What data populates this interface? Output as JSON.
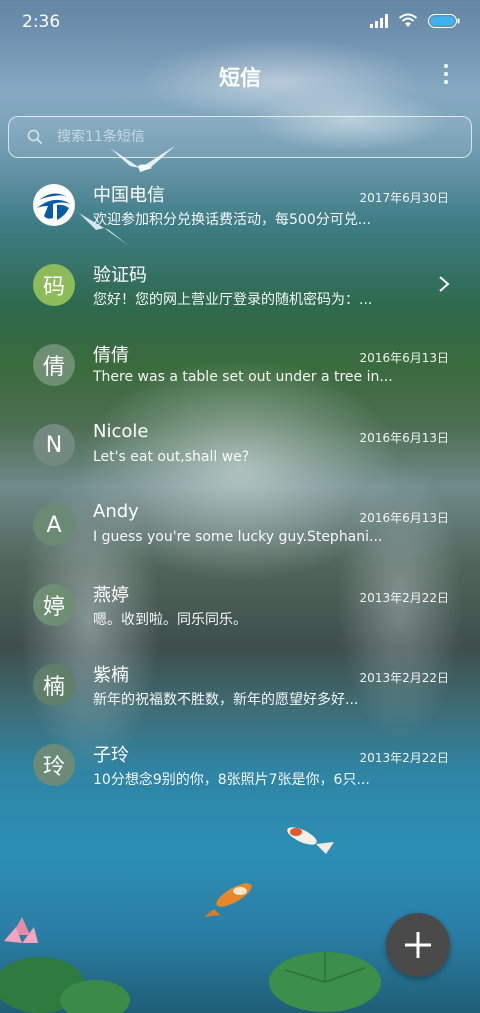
{
  "status_bar": {
    "time": "2:36"
  },
  "header": {
    "title": "短信"
  },
  "search": {
    "placeholder": "搜索11条短信"
  },
  "conversations": [
    {
      "name": "中国电信",
      "date": "2017年6月30日",
      "preview": "欢迎参加积分兑换话费活动，每500分可兑...",
      "avatar_type": "logo",
      "avatar_color": "#ffffff"
    },
    {
      "name": "验证码",
      "date": "",
      "preview": "您好！您的网上营业厅登录的随机密码为：...",
      "avatar_text": "码",
      "avatar_color": "#8dbb5a",
      "has_chevron": true
    },
    {
      "name": "倩倩",
      "date": "2016年6月13日",
      "preview": "There was a table set out under a tree in...",
      "avatar_text": "倩",
      "avatar_color": "#6e8f73"
    },
    {
      "name": "Nicole",
      "date": "2016年6月13日",
      "preview": "Let's eat out,shall we?",
      "avatar_text": "N",
      "avatar_color": "#748a80"
    },
    {
      "name": "Andy",
      "date": "2016年6月13日",
      "preview": "I guess you're some lucky guy.Stephani...",
      "avatar_text": "A",
      "avatar_color": "#6b8a73"
    },
    {
      "name": "燕婷",
      "date": "2013年2月22日",
      "preview": "嗯。收到啦。同乐同乐。",
      "avatar_text": "婷",
      "avatar_color": "#6e8f73"
    },
    {
      "name": "紫楠",
      "date": "2013年2月22日",
      "preview": "新年的祝福数不胜数，新年的愿望好多好...",
      "avatar_text": "楠",
      "avatar_color": "#5f7f6a"
    },
    {
      "name": "子玲",
      "date": "2013年2月22日",
      "preview": "10分想念9别的你，8张照片7张是你，6只...",
      "avatar_text": "玲",
      "avatar_color": "#6b8a78"
    }
  ],
  "icons": {
    "search": "search-icon",
    "more": "more-vert-icon",
    "compose": "plus-icon",
    "chevron": "chevron-right-icon",
    "brand_logo": "china-telecom-logo-icon"
  },
  "colors": {
    "fab": "#4a4a4a",
    "battery": "#3fb3f0"
  }
}
